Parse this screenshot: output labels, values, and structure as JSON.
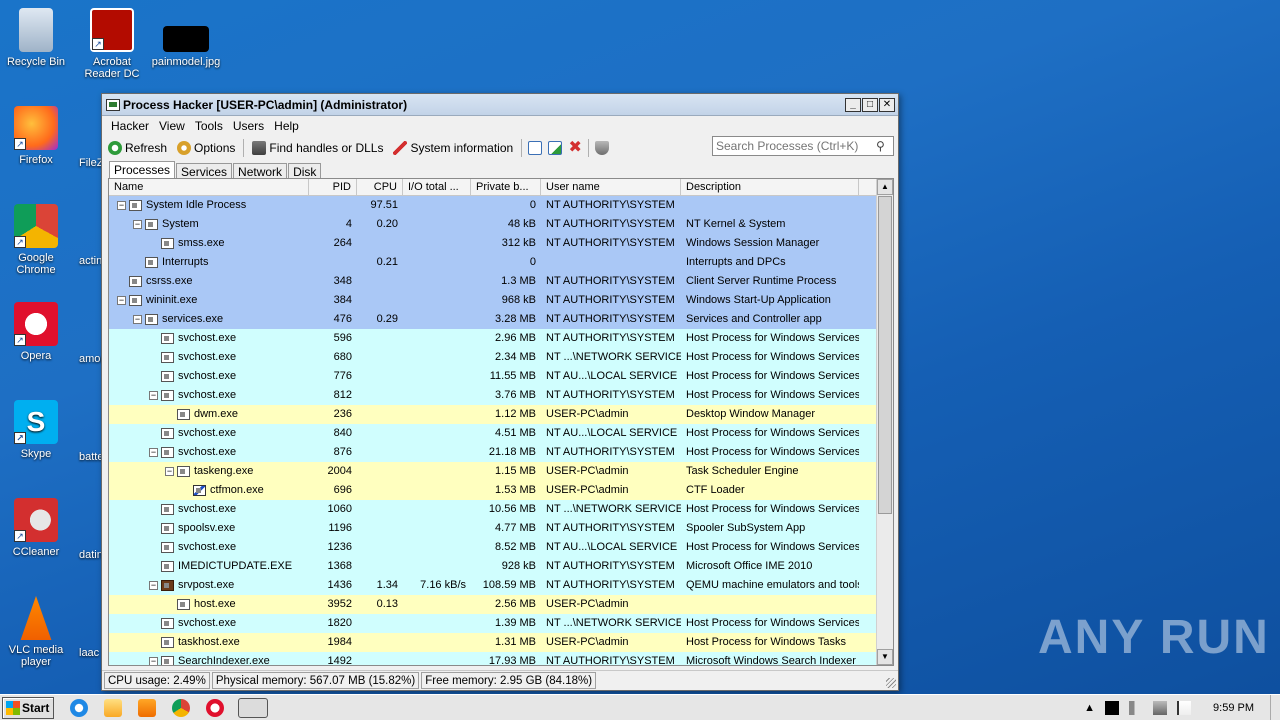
{
  "desktop": {
    "icons": [
      {
        "label": "Recycle Bin",
        "name": "recycle-bin-icon"
      },
      {
        "label": "Acrobat Reader DC",
        "name": "acrobat-reader-icon"
      },
      {
        "label": "painmodel.jpg",
        "name": "image-file-icon"
      },
      {
        "label": "Firefox",
        "name": "firefox-icon"
      },
      {
        "label": "Google Chrome",
        "name": "chrome-icon"
      },
      {
        "label": "Opera",
        "name": "opera-icon"
      },
      {
        "label": "Skype",
        "name": "skype-icon"
      },
      {
        "label": "CCleaner",
        "name": "ccleaner-icon"
      },
      {
        "label": "VLC media player",
        "name": "vlc-icon"
      }
    ],
    "partial_labels": [
      "FileZ",
      "actin",
      "amor",
      "batte",
      "datin",
      "laac"
    ],
    "watermark": "ANY RUN"
  },
  "window": {
    "title": "Process Hacker [USER-PC\\admin] (Administrator)",
    "menu": [
      "Hacker",
      "View",
      "Tools",
      "Users",
      "Help"
    ],
    "toolbar": {
      "refresh": "Refresh",
      "options": "Options",
      "find_handles": "Find handles or DLLs",
      "system_information": "System information"
    },
    "search": {
      "placeholder": "Search Processes (Ctrl+K)"
    },
    "tabs": [
      "Processes",
      "Services",
      "Network",
      "Disk"
    ],
    "columns": [
      "Name",
      "PID",
      "CPU",
      "I/O total ...",
      "Private b...",
      "User name",
      "Description"
    ],
    "processes": [
      {
        "indent": 0,
        "toggle": "−",
        "name": "System Idle Process",
        "pid": "",
        "cpu": "97.51",
        "io": "",
        "priv": "0",
        "user": "NT AUTHORITY\\SYSTEM",
        "desc": "",
        "color": "sys"
      },
      {
        "indent": 1,
        "toggle": "−",
        "name": "System",
        "pid": "4",
        "cpu": "0.20",
        "io": "",
        "priv": "48 kB",
        "user": "NT AUTHORITY\\SYSTEM",
        "desc": "NT Kernel & System",
        "color": "sys"
      },
      {
        "indent": 2,
        "toggle": "",
        "name": "smss.exe",
        "pid": "264",
        "cpu": "",
        "io": "",
        "priv": "312 kB",
        "user": "NT AUTHORITY\\SYSTEM",
        "desc": "Windows Session Manager",
        "color": "sys"
      },
      {
        "indent": 1,
        "toggle": "",
        "name": "Interrupts",
        "pid": "",
        "cpu": "0.21",
        "io": "",
        "priv": "0",
        "user": "",
        "desc": "Interrupts and DPCs",
        "color": "sys"
      },
      {
        "indent": 0,
        "toggle": "",
        "name": "csrss.exe",
        "pid": "348",
        "cpu": "",
        "io": "",
        "priv": "1.3 MB",
        "user": "NT AUTHORITY\\SYSTEM",
        "desc": "Client Server Runtime Process",
        "color": "sys"
      },
      {
        "indent": 0,
        "toggle": "−",
        "name": "wininit.exe",
        "pid": "384",
        "cpu": "",
        "io": "",
        "priv": "968 kB",
        "user": "NT AUTHORITY\\SYSTEM",
        "desc": "Windows Start-Up Application",
        "color": "sys"
      },
      {
        "indent": 1,
        "toggle": "−",
        "name": "services.exe",
        "pid": "476",
        "cpu": "0.29",
        "io": "",
        "priv": "3.28 MB",
        "user": "NT AUTHORITY\\SYSTEM",
        "desc": "Services and Controller app",
        "color": "sys"
      },
      {
        "indent": 2,
        "toggle": "",
        "name": "svchost.exe",
        "pid": "596",
        "cpu": "",
        "io": "",
        "priv": "2.96 MB",
        "user": "NT AUTHORITY\\SYSTEM",
        "desc": "Host Process for Windows Services",
        "color": "svc"
      },
      {
        "indent": 2,
        "toggle": "",
        "name": "svchost.exe",
        "pid": "680",
        "cpu": "",
        "io": "",
        "priv": "2.34 MB",
        "user": "NT ...\\NETWORK SERVICE",
        "desc": "Host Process for Windows Services",
        "color": "svc"
      },
      {
        "indent": 2,
        "toggle": "",
        "name": "svchost.exe",
        "pid": "776",
        "cpu": "",
        "io": "",
        "priv": "11.55 MB",
        "user": "NT AU...\\LOCAL SERVICE",
        "desc": "Host Process for Windows Services",
        "color": "svc"
      },
      {
        "indent": 2,
        "toggle": "−",
        "name": "svchost.exe",
        "pid": "812",
        "cpu": "",
        "io": "",
        "priv": "3.76 MB",
        "user": "NT AUTHORITY\\SYSTEM",
        "desc": "Host Process for Windows Services",
        "color": "svc"
      },
      {
        "indent": 3,
        "toggle": "",
        "name": "dwm.exe",
        "pid": "236",
        "cpu": "",
        "io": "",
        "priv": "1.12 MB",
        "user": "USER-PC\\admin",
        "desc": "Desktop Window Manager",
        "color": "user"
      },
      {
        "indent": 2,
        "toggle": "",
        "name": "svchost.exe",
        "pid": "840",
        "cpu": "",
        "io": "",
        "priv": "4.51 MB",
        "user": "NT AU...\\LOCAL SERVICE",
        "desc": "Host Process for Windows Services",
        "color": "svc"
      },
      {
        "indent": 2,
        "toggle": "−",
        "name": "svchost.exe",
        "pid": "876",
        "cpu": "",
        "io": "",
        "priv": "21.18 MB",
        "user": "NT AUTHORITY\\SYSTEM",
        "desc": "Host Process for Windows Services",
        "color": "svc"
      },
      {
        "indent": 3,
        "toggle": "−",
        "name": "taskeng.exe",
        "pid": "2004",
        "cpu": "",
        "io": "",
        "priv": "1.15 MB",
        "user": "USER-PC\\admin",
        "desc": "Task Scheduler Engine",
        "color": "user"
      },
      {
        "indent": 4,
        "toggle": "",
        "name": "ctfmon.exe",
        "pid": "696",
        "cpu": "",
        "io": "",
        "priv": "1.53 MB",
        "user": "USER-PC\\admin",
        "desc": "CTF Loader",
        "color": "user",
        "icon": "ctf"
      },
      {
        "indent": 2,
        "toggle": "",
        "name": "svchost.exe",
        "pid": "1060",
        "cpu": "",
        "io": "",
        "priv": "10.56 MB",
        "user": "NT ...\\NETWORK SERVICE",
        "desc": "Host Process for Windows Services",
        "color": "svc"
      },
      {
        "indent": 2,
        "toggle": "",
        "name": "spoolsv.exe",
        "pid": "1196",
        "cpu": "",
        "io": "",
        "priv": "4.77 MB",
        "user": "NT AUTHORITY\\SYSTEM",
        "desc": "Spooler SubSystem App",
        "color": "svc"
      },
      {
        "indent": 2,
        "toggle": "",
        "name": "svchost.exe",
        "pid": "1236",
        "cpu": "",
        "io": "",
        "priv": "8.52 MB",
        "user": "NT AU...\\LOCAL SERVICE",
        "desc": "Host Process for Windows Services",
        "color": "svc"
      },
      {
        "indent": 2,
        "toggle": "",
        "name": "IMEDICTUPDATE.EXE",
        "pid": "1368",
        "cpu": "",
        "io": "",
        "priv": "928 kB",
        "user": "NT AUTHORITY\\SYSTEM",
        "desc": "Microsoft Office IME 2010",
        "color": "svc"
      },
      {
        "indent": 2,
        "toggle": "−",
        "name": "srvpost.exe",
        "pid": "1436",
        "cpu": "1.34",
        "io": "7.16 kB/s",
        "priv": "108.59 MB",
        "user": "NT AUTHORITY\\SYSTEM",
        "desc": "QEMU machine emulators and tools",
        "color": "svc",
        "icon": "srv"
      },
      {
        "indent": 3,
        "toggle": "",
        "name": "host.exe",
        "pid": "3952",
        "cpu": "0.13",
        "io": "",
        "priv": "2.56 MB",
        "user": "USER-PC\\admin",
        "desc": "",
        "color": "user"
      },
      {
        "indent": 2,
        "toggle": "",
        "name": "svchost.exe",
        "pid": "1820",
        "cpu": "",
        "io": "",
        "priv": "1.39 MB",
        "user": "NT ...\\NETWORK SERVICE",
        "desc": "Host Process for Windows Services",
        "color": "svc"
      },
      {
        "indent": 2,
        "toggle": "",
        "name": "taskhost.exe",
        "pid": "1984",
        "cpu": "",
        "io": "",
        "priv": "1.31 MB",
        "user": "USER-PC\\admin",
        "desc": "Host Process for Windows Tasks",
        "color": "user"
      },
      {
        "indent": 2,
        "toggle": "−",
        "name": "SearchIndexer.exe",
        "pid": "1492",
        "cpu": "",
        "io": "",
        "priv": "17.93 MB",
        "user": "NT AUTHORITY\\SYSTEM",
        "desc": "Microsoft Windows Search Indexer",
        "color": "svc"
      }
    ],
    "status": {
      "cpu": "CPU usage: 2.49%",
      "physical": "Physical memory: 567.07 MB (15.82%)",
      "free": "Free memory: 2.95 GB (84.18%)"
    }
  },
  "taskbar": {
    "start": "Start",
    "clock": "9:59 PM"
  }
}
